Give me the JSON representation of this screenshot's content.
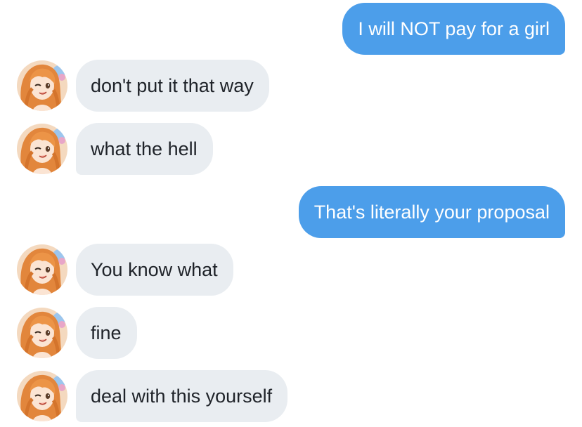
{
  "messages": [
    {
      "direction": "out",
      "text": "I will NOT pay for a girl"
    },
    {
      "direction": "in",
      "text": "don't put it that way"
    },
    {
      "direction": "in",
      "text": "what the hell"
    },
    {
      "direction": "out",
      "text": "That's literally your proposal"
    },
    {
      "direction": "in",
      "text": "You know what"
    },
    {
      "direction": "in",
      "text": "fine"
    },
    {
      "direction": "in",
      "text": "deal with this yourself"
    }
  ],
  "colors": {
    "outgoing_bubble": "#4c9eea",
    "incoming_bubble": "#e9edf1",
    "incoming_text": "#1f2329",
    "outgoing_text": "#ffffff"
  },
  "avatar": {
    "icon": "contact-avatar-icon"
  }
}
